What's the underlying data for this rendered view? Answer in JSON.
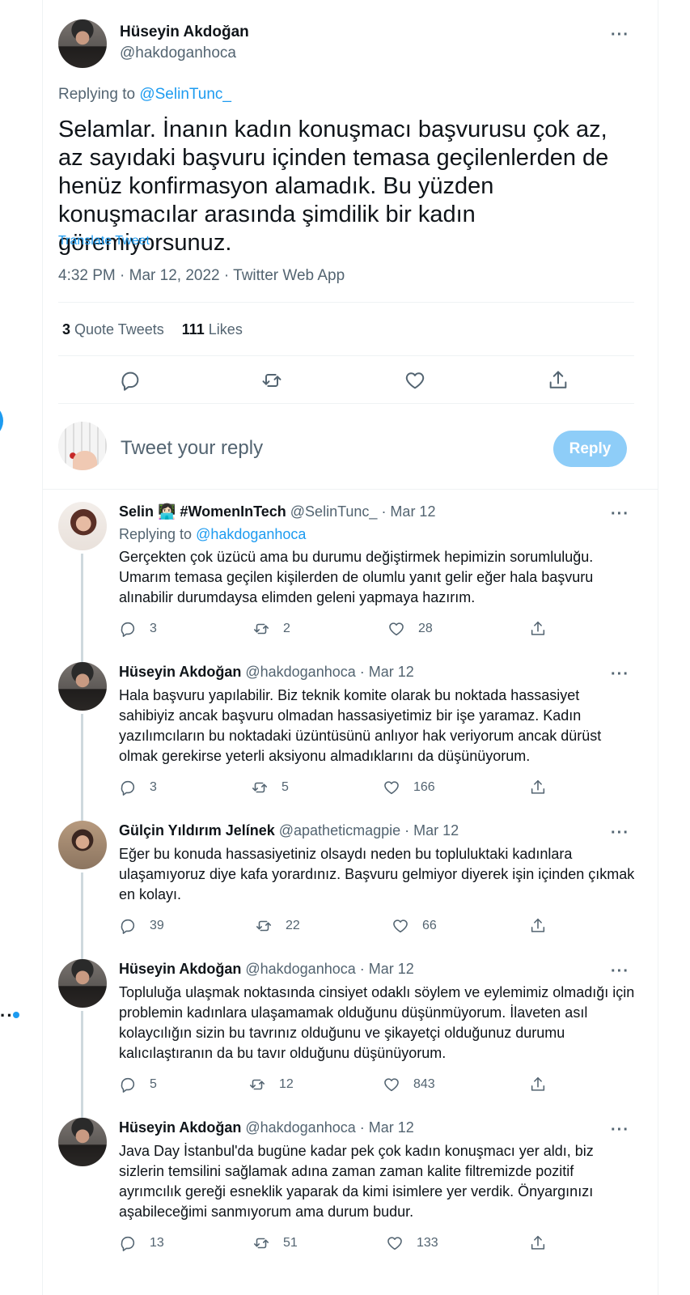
{
  "main_tweet": {
    "author_name": "Hüseyin Akdoğan",
    "author_handle": "@hakdoganhoca",
    "replying_prefix": "Replying to ",
    "replying_handle": "@SelinTunc_",
    "text": "Selamlar. İnanın kadın konuşmacı başvurusu çok az, az sayıdaki başvuru içinden temasa geçilenlerden de henüz konfirmasyon alamadık. Bu yüzden konuşmacılar arasında şimdilik bir kadın göremiyorsunuz.",
    "translate_label": "Translate Tweet",
    "timestamp": "4:32 PM · Mar 12, 2022 · Twitter Web App",
    "quote_tweets_count": "3",
    "quote_tweets_label": " Quote Tweets",
    "likes_count": "111",
    "likes_label": " Likes",
    "more_icon": "more-icon"
  },
  "reply_box": {
    "placeholder": "Tweet your reply",
    "button_label": "Reply"
  },
  "replies": [
    {
      "name": "Selin 👩🏻‍💻 #WomenInTech",
      "meta": " @SelinTunc_ · Mar 12",
      "replying_prefix": "Replying to ",
      "replying_handle": "@hakdoganhoca",
      "text": "Gerçekten çok üzücü ama bu durumu değiştirmek hepimizin sorumluluğu. Umarım temasa geçilen kişilerden de olumlu yanıt gelir eğer hala başvuru alınabilir durumdaysa elimden geleni yapmaya hazırım.",
      "replies": "3",
      "retweets": "2",
      "likes": "28"
    },
    {
      "name": "Hüseyin Akdoğan",
      "meta": " @hakdoganhoca · Mar 12",
      "text": "Hala başvuru yapılabilir. Biz teknik komite olarak bu noktada hassasiyet sahibiyiz ancak başvuru olmadan hassasiyetimiz bir işe yaramaz. Kadın yazılımcıların bu noktadaki üzüntüsünü anlıyor hak veriyorum ancak dürüst olmak gerekirse yeterli aksiyonu almadıklarını da düşünüyorum.",
      "replies": "3",
      "retweets": "5",
      "likes": "166"
    },
    {
      "name": "Gülçin Yıldırım Jelínek",
      "meta": " @apatheticmagpie · Mar 12",
      "text": "Eğer bu konuda hassasiyetiniz olsaydı neden bu topluluktaki kadınlara ulaşamıyoruz diye kafa yorardınız. Başvuru gelmiyor diyerek işin içinden çıkmak en kolayı.",
      "replies": "39",
      "retweets": "22",
      "likes": "66"
    },
    {
      "name": "Hüseyin Akdoğan",
      "meta": " @hakdoganhoca · Mar 12",
      "text": "Topluluğa ulaşmak noktasında cinsiyet odaklı söylem ve eylemimiz olmadığı için problemin kadınlara ulaşamamak olduğunu düşünmüyorum. İlaveten asıl kolaycılığın sizin bu tavrınız olduğunu ve şikayetçi olduğunuz durumu kalıcılaştıranın da bu tavır olduğunu düşünüyorum.",
      "replies": "5",
      "retweets": "12",
      "likes": "843"
    },
    {
      "name": "Hüseyin Akdoğan",
      "meta": " @hakdoganhoca · Mar 12",
      "text": "Java Day İstanbul'da bugüne kadar pek çok kadın konuşmacı yer aldı, biz sizlerin temsilini sağlamak adına zaman zaman kalite filtremizde pozitif ayrımcılık gereği esneklik yaparak da kimi isimlere yer verdik. Önyargınızı aşabileceğimi sanmıyorum ama durum budur.",
      "replies": "13",
      "retweets": "51",
      "likes": "133"
    }
  ],
  "icons": {
    "reply": "reply-icon",
    "retweet": "retweet-icon",
    "like": "heart-icon",
    "share": "share-icon"
  },
  "colors": {
    "accent": "#1d9bf0",
    "secondary_text": "#536471",
    "reply_button_disabled": "#8ecdf8"
  }
}
